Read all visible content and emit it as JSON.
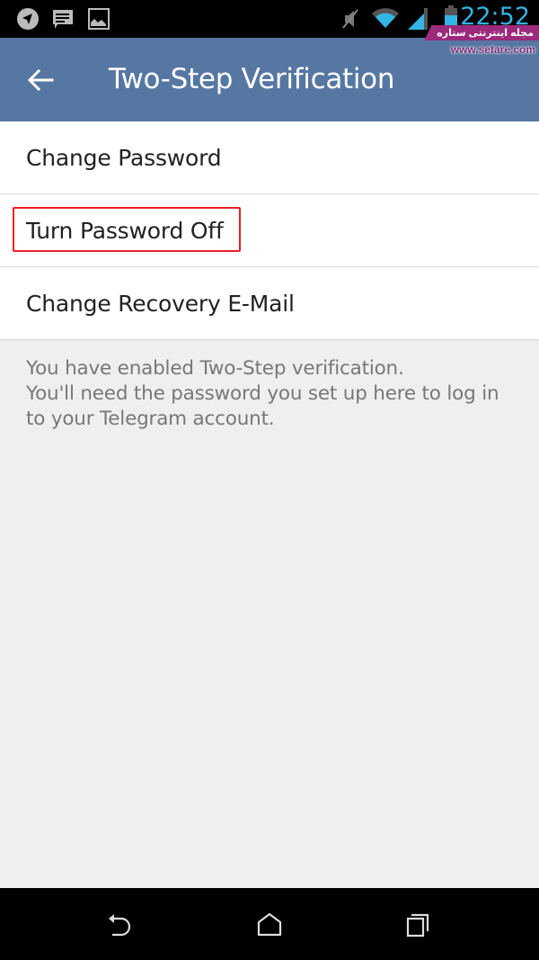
{
  "status_bar": {
    "time": "22:52",
    "left_icons": [
      "telegram-icon",
      "message-icon",
      "image-icon"
    ],
    "right_icons": [
      "mute-icon",
      "wifi-icon",
      "signal-icon",
      "battery-icon"
    ]
  },
  "watermark": {
    "title_fa": "مجله اینترنتی ستاره",
    "url": "www.setare.com"
  },
  "header": {
    "title": "Two-Step Verification",
    "back_icon": "arrow-left-icon"
  },
  "menu": {
    "items": [
      {
        "label": "Change Password"
      },
      {
        "label": "Turn Password Off",
        "highlighted": true
      },
      {
        "label": "Change Recovery E-Mail"
      }
    ]
  },
  "info": {
    "line1": "You have enabled Two-Step verification.",
    "line2": "You'll need the password you set up here to log in to your Telegram account."
  },
  "nav_bar": {
    "buttons": [
      "back-icon",
      "home-icon",
      "recents-icon"
    ]
  },
  "colors": {
    "header": "#5677a2",
    "highlight": "#e8202a",
    "clock": "#33b5e5"
  }
}
